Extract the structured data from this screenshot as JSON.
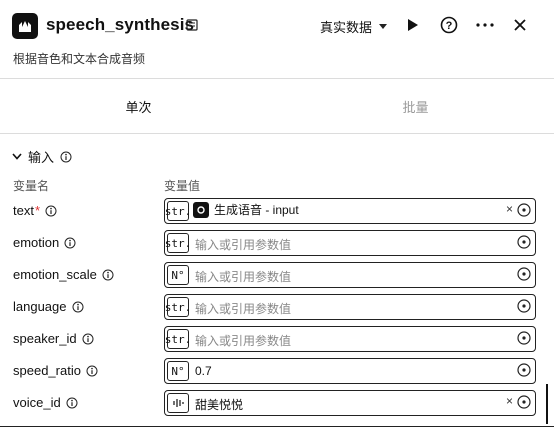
{
  "header": {
    "title": "speech_synthesis",
    "data_mode": "真实数据",
    "icons": [
      "app-logo-icon",
      "edit-icon",
      "chevron-down-icon",
      "play-icon",
      "help-icon",
      "more-icon",
      "close-icon"
    ]
  },
  "subtitle": "根据音色和文本合成音频",
  "tabs": [
    {
      "label": "单次",
      "active": true
    },
    {
      "label": "批量",
      "active": false
    }
  ],
  "section": {
    "title": "输入",
    "col_name": "变量名",
    "col_value": "变量值"
  },
  "params": [
    {
      "name": "text",
      "required": true,
      "type": "str.",
      "kind": "ref",
      "value": "生成语音 - input"
    },
    {
      "name": "emotion",
      "type": "str.",
      "kind": "input",
      "placeholder": "输入或引用参数值"
    },
    {
      "name": "emotion_scale",
      "type": "N⃝",
      "type_label": "N°",
      "kind": "input",
      "placeholder": "输入或引用参数值"
    },
    {
      "name": "language",
      "type": "str.",
      "kind": "input",
      "placeholder": "输入或引用参数值"
    },
    {
      "name": "speaker_id",
      "type": "str.",
      "kind": "input",
      "placeholder": "输入或引用参数值"
    },
    {
      "name": "speed_ratio",
      "type": "N°",
      "kind": "value",
      "value": "0.7"
    },
    {
      "name": "voice_id",
      "type": "voice",
      "kind": "voice",
      "value": "甜美悦悦"
    }
  ],
  "colors": {
    "border": "#222222",
    "placeholder": "#888888",
    "inactive_tab": "#9a9a9a",
    "required": "#dd3333"
  }
}
